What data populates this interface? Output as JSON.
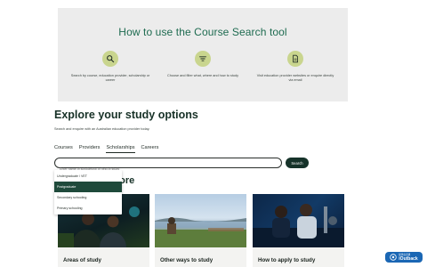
{
  "howto": {
    "title": "How to use the Course Search tool",
    "steps": [
      {
        "icon": "search-icon",
        "text": "Search by course, education provider, scholarship or career"
      },
      {
        "icon": "filter-icon",
        "text": "Choose and filter what, where and how to study"
      },
      {
        "icon": "document-icon",
        "text": "Visit education provider websites or enquire directly via email"
      }
    ]
  },
  "explore": {
    "heading": "Explore your study options",
    "subtitle": "Search and enquire with an Australian education provider today.",
    "tabs": [
      "Courses",
      "Providers",
      "Scholarships",
      "Careers"
    ],
    "active_tab": "Scholarships",
    "search_placeholder": "Enter name of scholarship or field of study",
    "search_button": "Search",
    "dropdown": [
      "Undergraduate / VET",
      "Postgraduate",
      "Secondary schooling",
      "Primary schooling"
    ],
    "dropdown_selected": "Postgraduate"
  },
  "more": {
    "heading": "r more",
    "cards": [
      {
        "caption": "Areas of study",
        "image": "photo-students"
      },
      {
        "caption": "Other ways to study",
        "image": "photo-lake"
      },
      {
        "caption": "How to apply to study",
        "image": "photo-laboratory"
      }
    ]
  },
  "brand_badge": {
    "line1": "提供信息通",
    "line2": "iOutback"
  },
  "colors": {
    "accent_green": "#1e6b50",
    "dark_green": "#16332a",
    "icon_badge": "#c9d58e",
    "panel_bg": "#ececec",
    "badge_blue": "#1b67b4"
  }
}
